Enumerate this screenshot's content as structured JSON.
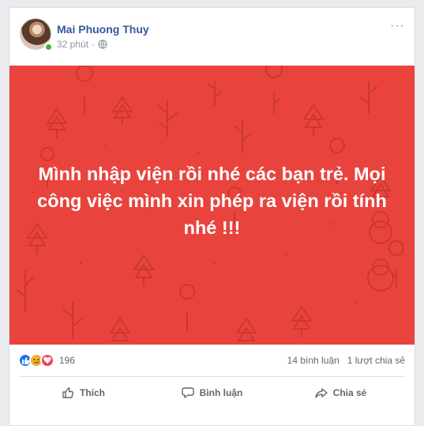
{
  "post": {
    "author": "Mai Phuong Thuy",
    "time": "32 phút",
    "privacy_icon": "globe-icon",
    "text": "Mình nhập viện rồi nhé các bạn trẻ. Mọi công việc mình xin phép ra viện rồi tính nhé !!!",
    "background_color": "#e8443d"
  },
  "stats": {
    "reactions": [
      "like-icon",
      "sad-icon",
      "love-icon"
    ],
    "reaction_count": "196",
    "comments": "14 bình luận",
    "shares": "1 lượt chia sẻ"
  },
  "actions": {
    "like": "Thích",
    "comment": "Bình luận",
    "share": "Chia sẻ"
  }
}
